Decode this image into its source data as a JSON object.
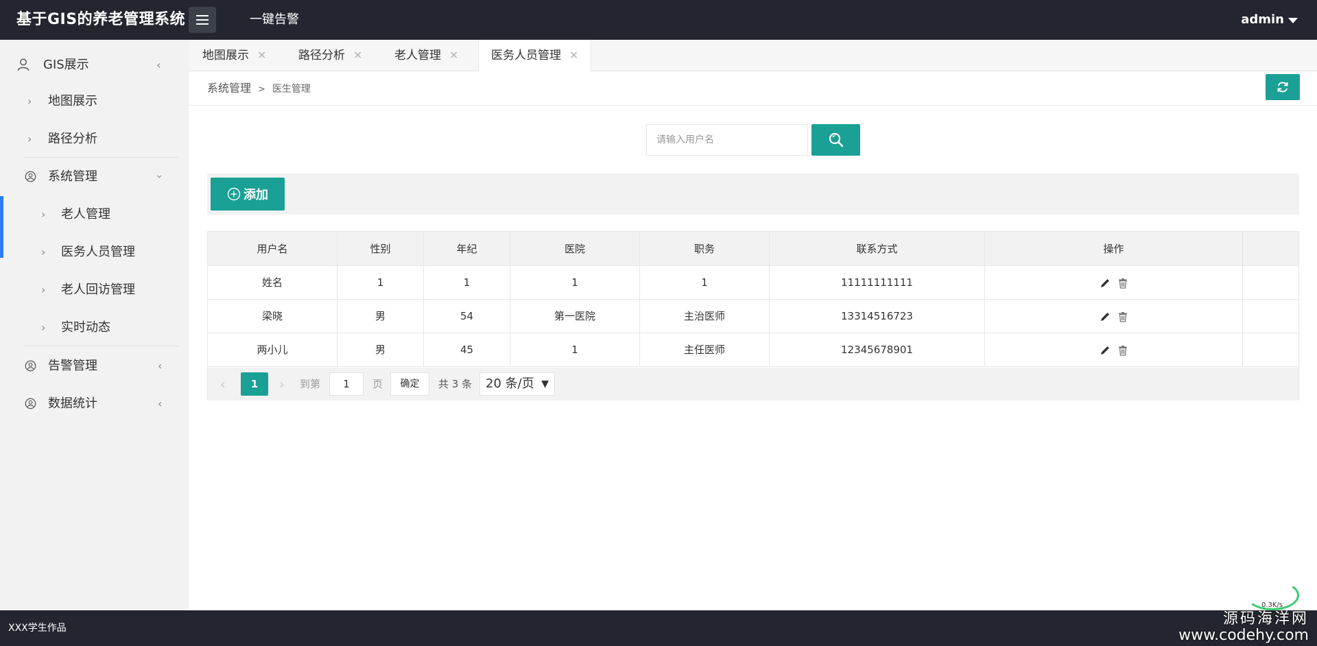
{
  "header": {
    "app_title": "基于GIS的养老管理系统",
    "alarm_label": "一键告警",
    "user": "admin"
  },
  "sidebar": {
    "items": [
      {
        "label": "GIS展示",
        "icon": "user-icon"
      },
      {
        "label": "地图展示"
      },
      {
        "label": "路径分析"
      },
      {
        "label": "系统管理",
        "icon": "user-circle-icon"
      },
      {
        "label": "老人管理"
      },
      {
        "label": "医务人员管理"
      },
      {
        "label": "老人回访管理"
      },
      {
        "label": "实时动态"
      },
      {
        "label": "告警管理",
        "icon": "user-circle-icon"
      },
      {
        "label": "数据统计",
        "icon": "user-circle-icon"
      }
    ]
  },
  "tabs": [
    {
      "label": "地图展示"
    },
    {
      "label": "路径分析"
    },
    {
      "label": "老人管理"
    },
    {
      "label": "医务人员管理",
      "active": true
    }
  ],
  "breadcrumb": {
    "parent": "系统管理",
    "separator": ">",
    "current": "医生管理"
  },
  "search": {
    "placeholder": "请输入用户名"
  },
  "toolbar": {
    "add_label": "添加"
  },
  "table": {
    "headers": [
      "用户名",
      "性别",
      "年纪",
      "医院",
      "职务",
      "联系方式",
      "操作"
    ],
    "rows": [
      [
        "姓名",
        "1",
        "1",
        "1",
        "1",
        "11111111111"
      ],
      [
        "梁晓",
        "男",
        "54",
        "第一医院",
        "主治医师",
        "13314516723"
      ],
      [
        "两小儿",
        "男",
        "45",
        "1",
        "主任医师",
        "12345678901"
      ]
    ]
  },
  "pagination": {
    "current_page": "1",
    "goto_label": "到第",
    "goto_value": "1",
    "page_unit": "页",
    "confirm_label": "确定",
    "total_label": "共 3 条",
    "page_size": "20 条/页"
  },
  "footer": {
    "credit": "XXX学生作品",
    "watermark_cn": "源码海洋网",
    "watermark_url": "www.codehy.com"
  },
  "net_speed": "0.3K/s",
  "colors": {
    "header_bg": "#23262e",
    "accent": "#1aa094",
    "active_indicator": "#2d7cf6",
    "sidebar_bg": "#f2f2f2"
  }
}
